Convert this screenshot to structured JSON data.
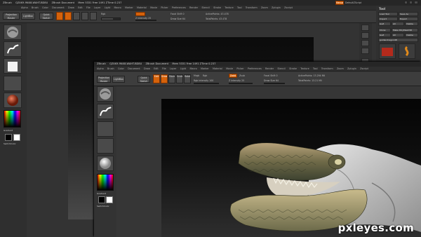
{
  "back_window": {
    "title_items": [
      "ZBrush",
      "QZ4K9-9NX8-WAHT-BD8U",
      "ZBrush Document",
      "Mem 5331 Free 1491 ZTime 0.237"
    ],
    "menu_items": [
      "Alpha",
      "Brush",
      "Color",
      "Document",
      "Draw",
      "Edit",
      "File",
      "Layer",
      "Light",
      "Macro",
      "Marker",
      "Material",
      "Movie",
      "Picker",
      "Preferences",
      "Render",
      "Stencil",
      "Stroke",
      "Texture",
      "Tool",
      "Transform",
      "Zoom",
      "Zplugin",
      "Zscript"
    ],
    "projection_label": "Projection Master",
    "lightbox_label": "LightBox",
    "quick_sketch_label": "Quick Sketch",
    "focal_shift": "Focal Shift 0",
    "active_points": "ActivePoints: 43.478",
    "draw_size": "Draw Size 64",
    "total_points": "TotalPoints: 43.478",
    "rgb_label": "Rgb",
    "z_intensity": "Z Intensity 25",
    "menus_label": "Menus",
    "default_script": "DefaultZScript",
    "tool_title": "Tool",
    "load_tool": "Load Tool",
    "save_as": "Save As",
    "import_label": "Import",
    "export_label": "Export",
    "gozi_label": "GoZ",
    "all_label": "All",
    "visible_label": "Visible",
    "clone_label": "Clone",
    "make_polymesh": "Make PolyMesh3D",
    "goz_label": "GoZ",
    "all_label2": "All",
    "visible_label2": "Visible",
    "subtool_label": "goldendragon48",
    "gradient_label": "Gradient",
    "switch_color_label": "SwitchColor"
  },
  "front_window": {
    "title_items": [
      "ZBrush",
      "QZ4K9-9NX8-WAHT-BD8U",
      "ZBrush Document",
      "Mem 5331 Free 1491 ZTime 0.237"
    ],
    "menu_items": [
      "Alpha",
      "Brush",
      "Color",
      "Document",
      "Draw",
      "Edit",
      "File",
      "Layer",
      "Light",
      "Macro",
      "Marker",
      "Material",
      "Movie",
      "Picker",
      "Preferences",
      "Render",
      "Stencil",
      "Stroke",
      "Texture",
      "Tool",
      "Transform",
      "Zoom",
      "Zplugin",
      "Zscript"
    ],
    "projection_label": "Projection Master",
    "lightbox_label": "LightBox",
    "quick_sketch_label": "Quick Sketch",
    "focal_shift": "Focal Shift 0",
    "active_points": "ActivePoints: 13.294 Mil",
    "draw_size": "Draw Size 64",
    "total_points": "TotalPoints: 13.21 Mil",
    "rgb_intensity": "Rgb Intensity 100",
    "z_intensity": "Z Intensity 25",
    "mrgb_label": "Mrgb",
    "rgb_label": "Rgb",
    "zadd_label": "Zadd",
    "zsub_label": "Zsub",
    "gradient_label": "Gradient",
    "switch_color_label": "SwitchColor",
    "tool_buttons": [
      "Edit",
      "Draw",
      "Move",
      "Scale",
      "Rotate"
    ]
  },
  "watermark": "pxleyes.com",
  "colors": {
    "accent_orange": "#d5620b",
    "panel_gray": "#3a3a3a",
    "canvas_black": "#0a0a0a"
  }
}
